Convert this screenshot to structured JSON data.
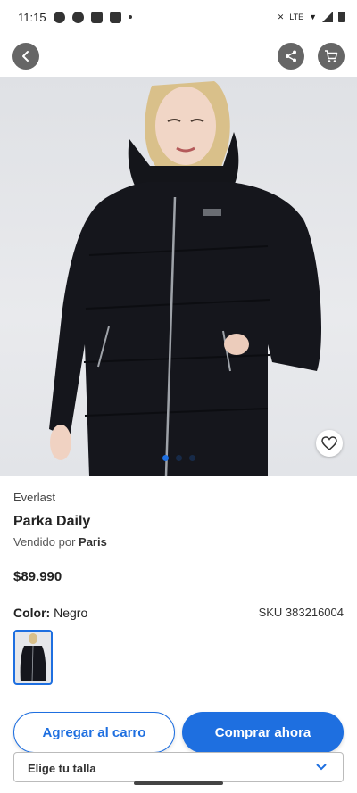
{
  "status_bar": {
    "time": "11:15",
    "network": "LTE"
  },
  "nav": {
    "back_icon": "chevron-left-icon",
    "share_icon": "share-icon",
    "cart_icon": "cart-icon"
  },
  "gallery": {
    "image": "woman wearing black long quilted parka",
    "pages": 3,
    "active_page": 1
  },
  "product": {
    "brand": "Everlast",
    "title": "Parka Daily",
    "seller_prefix": "Vendido por",
    "seller_name": "Paris",
    "price": "$89.990",
    "color_label": "Color:",
    "color_value": "Negro",
    "sku": "SKU 383216004"
  },
  "actions": {
    "add_to_cart": "Agregar al carro",
    "buy_now": "Comprar ahora"
  },
  "size": {
    "placeholder": "Elige tu talla"
  },
  "colors": {
    "accent": "#1e6fe0",
    "nav_button": "#666666"
  }
}
